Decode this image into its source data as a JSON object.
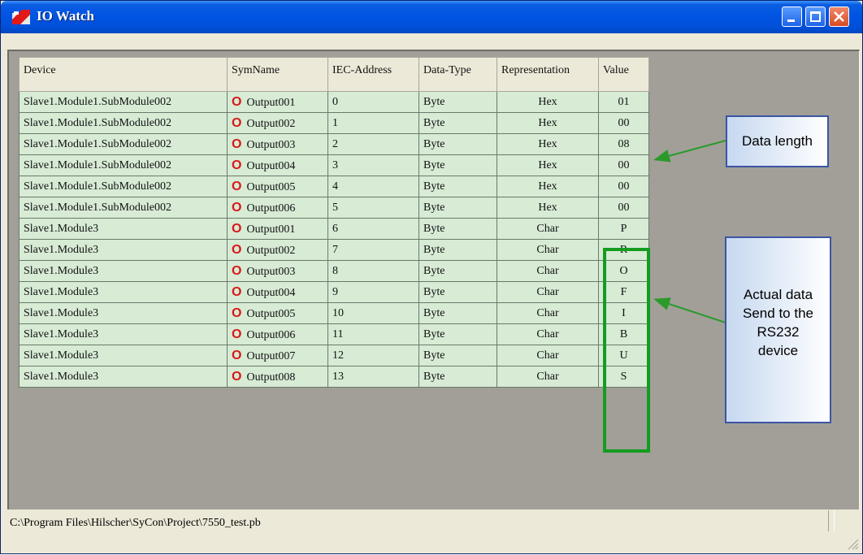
{
  "window": {
    "title": "IO Watch"
  },
  "table": {
    "headers": [
      "Device",
      "SymName",
      "IEC-Address",
      "Data-Type",
      "Representation",
      "Value"
    ],
    "rows": [
      {
        "device": "Slave1.Module1.SubModule002",
        "direction": "O",
        "symname": "Output001",
        "address": "0",
        "type": "Byte",
        "rep": "Hex",
        "value": "01"
      },
      {
        "device": "Slave1.Module1.SubModule002",
        "direction": "O",
        "symname": "Output002",
        "address": "1",
        "type": "Byte",
        "rep": "Hex",
        "value": "00"
      },
      {
        "device": "Slave1.Module1.SubModule002",
        "direction": "O",
        "symname": "Output003",
        "address": "2",
        "type": "Byte",
        "rep": "Hex",
        "value": "08"
      },
      {
        "device": "Slave1.Module1.SubModule002",
        "direction": "O",
        "symname": "Output004",
        "address": "3",
        "type": "Byte",
        "rep": "Hex",
        "value": "00"
      },
      {
        "device": "Slave1.Module1.SubModule002",
        "direction": "O",
        "symname": "Output005",
        "address": "4",
        "type": "Byte",
        "rep": "Hex",
        "value": "00"
      },
      {
        "device": "Slave1.Module1.SubModule002",
        "direction": "O",
        "symname": "Output006",
        "address": "5",
        "type": "Byte",
        "rep": "Hex",
        "value": "00"
      },
      {
        "device": "Slave1.Module3",
        "direction": "O",
        "symname": "Output001",
        "address": "6",
        "type": "Byte",
        "rep": "Char",
        "value": "P"
      },
      {
        "device": "Slave1.Module3",
        "direction": "O",
        "symname": "Output002",
        "address": "7",
        "type": "Byte",
        "rep": "Char",
        "value": "R"
      },
      {
        "device": "Slave1.Module3",
        "direction": "O",
        "symname": "Output003",
        "address": "8",
        "type": "Byte",
        "rep": "Char",
        "value": "O"
      },
      {
        "device": "Slave1.Module3",
        "direction": "O",
        "symname": "Output004",
        "address": "9",
        "type": "Byte",
        "rep": "Char",
        "value": "F"
      },
      {
        "device": "Slave1.Module3",
        "direction": "O",
        "symname": "Output005",
        "address": "10",
        "type": "Byte",
        "rep": "Char",
        "value": "I"
      },
      {
        "device": "Slave1.Module3",
        "direction": "O",
        "symname": "Output006",
        "address": "11",
        "type": "Byte",
        "rep": "Char",
        "value": "B"
      },
      {
        "device": "Slave1.Module3",
        "direction": "O",
        "symname": "Output007",
        "address": "12",
        "type": "Byte",
        "rep": "Char",
        "value": "U"
      },
      {
        "device": "Slave1.Module3",
        "direction": "O",
        "symname": "Output008",
        "address": "13",
        "type": "Byte",
        "rep": "Char",
        "value": "S"
      }
    ]
  },
  "annotations": {
    "data_length": "Data length",
    "actual_data": [
      "Actual data",
      "Send to the",
      "RS232",
      "device"
    ]
  },
  "statusbar": {
    "path": "C:\\Program Files\\Hilscher\\SyCon\\Project\\7550_test.pb"
  },
  "colors": {
    "title_bar": "#0054e3",
    "row_background": "#d7ebd5",
    "highlight_border": "#149c20",
    "arrow": "#2a9a2a",
    "direction_mark": "#d81818"
  },
  "icons": {
    "app": "io-watch-app-icon",
    "minimize": "minimize-icon",
    "maximize": "maximize-icon",
    "close": "close-icon",
    "resize_grip": "resize-grip-icon"
  }
}
